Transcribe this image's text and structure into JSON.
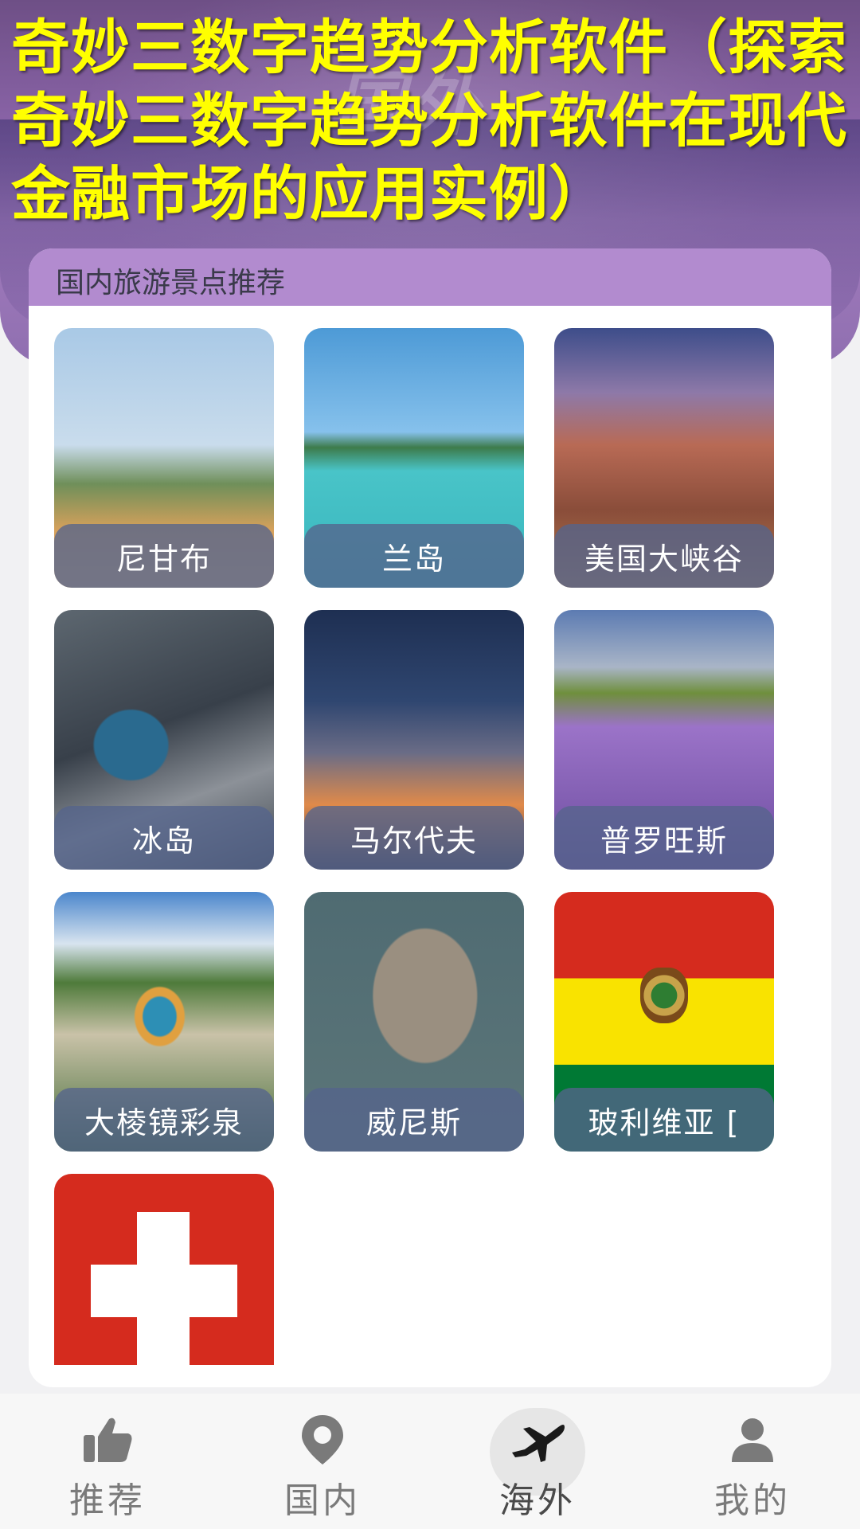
{
  "headline": "奇妙三数字趋势分析软件（探索奇妙三数字趋势分析软件在现代金融市场的应用实例）",
  "hero": {
    "watermark": "国外"
  },
  "section": {
    "title": "国内旅游景点推荐"
  },
  "destinations": [
    {
      "name": "尼甘布",
      "photo": "beach-resort-photo"
    },
    {
      "name": "兰岛",
      "photo": "tropical-island-photo"
    },
    {
      "name": "美国大峡谷",
      "photo": "grand-canyon-photo"
    },
    {
      "name": "冰岛",
      "photo": "iceland-aerial-photo"
    },
    {
      "name": "马尔代夫",
      "photo": "sunset-sky-photo"
    },
    {
      "name": "普罗旺斯",
      "photo": "lavender-field-photo"
    },
    {
      "name": "大棱镜彩泉",
      "photo": "prismatic-spring-photo"
    },
    {
      "name": "威尼斯",
      "photo": "venice-satellite-photo"
    },
    {
      "name": "玻利维亚 [",
      "photo": "bolivia-flag"
    },
    {
      "name": "",
      "photo": "switzerland-flag"
    }
  ],
  "colors": {
    "headline": "#ffff00",
    "section_header": "#b28bcf",
    "caption_bg": "#54648c"
  },
  "bottom_nav": {
    "items": [
      {
        "label": "推荐",
        "icon": "thumbs-up-icon",
        "active": false
      },
      {
        "label": "国内",
        "icon": "location-pin-icon",
        "active": false
      },
      {
        "label": "海外",
        "icon": "airplane-icon",
        "active": true
      },
      {
        "label": "我的",
        "icon": "user-icon",
        "active": false
      }
    ]
  }
}
